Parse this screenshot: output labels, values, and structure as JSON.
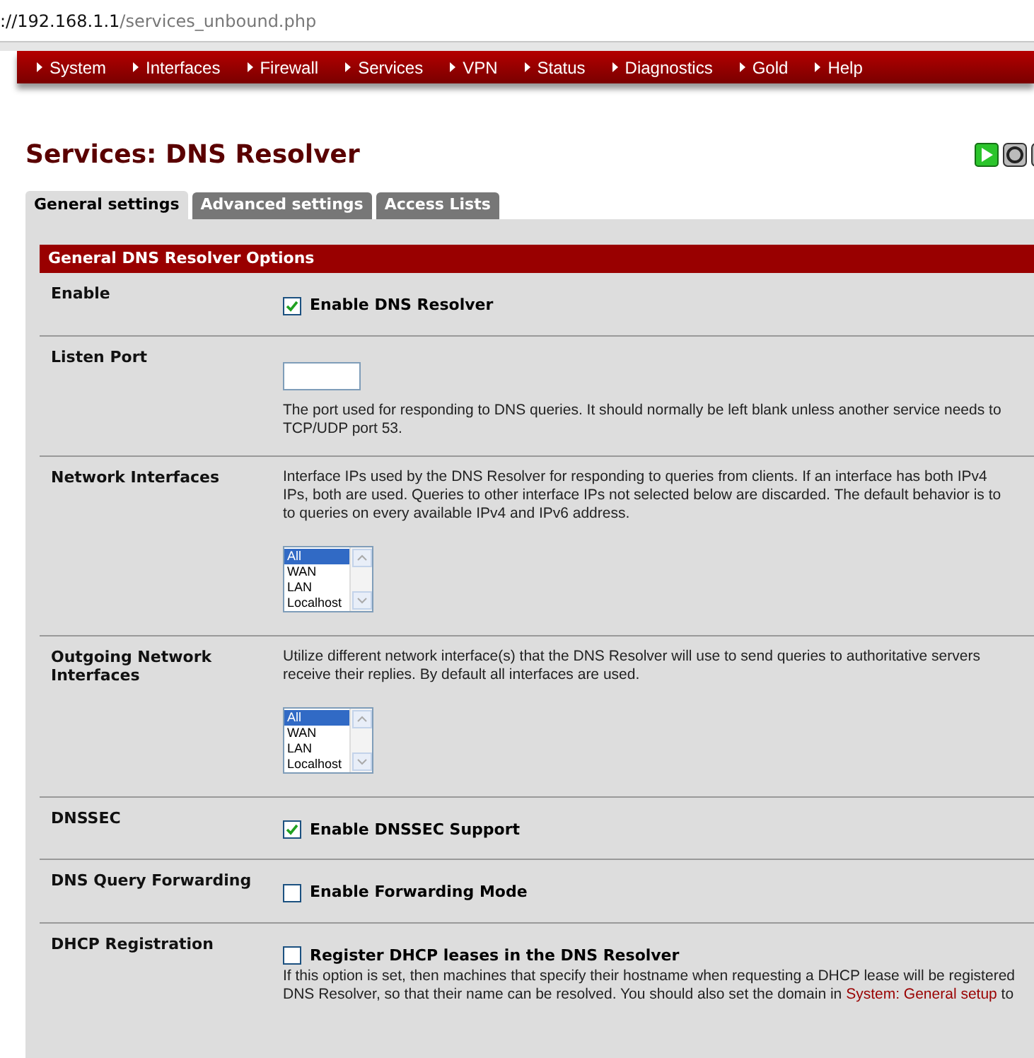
{
  "address_bar": {
    "host": "://192.168.1.1",
    "path": "/services_unbound.php"
  },
  "menu": [
    "System",
    "Interfaces",
    "Firewall",
    "Services",
    "VPN",
    "Status",
    "Diagnostics",
    "Gold",
    "Help"
  ],
  "page_title": "Services: DNS Resolver",
  "tabs": [
    {
      "label": "General settings",
      "selected": true
    },
    {
      "label": "Advanced settings",
      "selected": false
    },
    {
      "label": "Access Lists",
      "selected": false
    }
  ],
  "section_header": "General DNS Resolver Options",
  "rows": [
    {
      "kind": "checkbox",
      "label": "Enable",
      "checkbox_label": "Enable DNS Resolver",
      "checked": true
    },
    {
      "kind": "text",
      "label": "Listen Port",
      "value": "",
      "description": [
        "The port used for responding to DNS queries. It should normally be left blank unless another service needs to",
        "TCP/UDP port 53."
      ]
    },
    {
      "kind": "list",
      "label": "Network Interfaces",
      "description": [
        "Interface IPs used by the DNS Resolver for responding to queries from clients. If an interface has both IPv4",
        "IPs, both are used. Queries to other interface IPs not selected below are discarded. The default behavior is to",
        "to queries on every available IPv4 and IPv6 address."
      ],
      "options": [
        {
          "label": "All",
          "selected": true
        },
        {
          "label": "WAN",
          "selected": false
        },
        {
          "label": "LAN",
          "selected": false
        },
        {
          "label": "Localhost",
          "selected": false
        }
      ]
    },
    {
      "kind": "list",
      "label": "Outgoing Network Interfaces",
      "description": [
        "Utilize different network interface(s) that the DNS Resolver will use to send queries to authoritative servers",
        "receive their replies. By default all interfaces are used."
      ],
      "options": [
        {
          "label": "All",
          "selected": true
        },
        {
          "label": "WAN",
          "selected": false
        },
        {
          "label": "LAN",
          "selected": false
        },
        {
          "label": "Localhost",
          "selected": false
        }
      ]
    },
    {
      "kind": "checkbox",
      "label": "DNSSEC",
      "checkbox_label": "Enable DNSSEC Support",
      "checked": true
    },
    {
      "kind": "checkbox",
      "label": "DNS Query Forwarding",
      "checkbox_label": "Enable Forwarding Mode",
      "checked": false
    },
    {
      "kind": "checkbox",
      "label": "DHCP Registration",
      "checkbox_label": "Register DHCP leases in the DNS Resolver",
      "checked": false,
      "description": [
        "If this option is set, then machines that specify their hostname when requesting a DHCP lease will be registered",
        "DNS Resolver, so that their name can be resolved. You should also set the domain in"
      ],
      "link": "System: General setup",
      "after_link": "to"
    }
  ]
}
